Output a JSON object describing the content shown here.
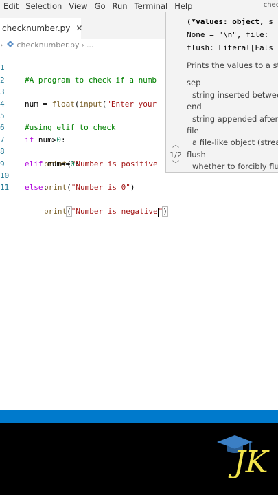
{
  "menu": {
    "items": [
      "Edit",
      "Selection",
      "View",
      "Go",
      "Run",
      "Terminal",
      "Help"
    ],
    "window_title_fragment": "check"
  },
  "tab": {
    "filename": "checknumber.py",
    "close_glyph": "✕"
  },
  "breadcrumb": {
    "chevron_left": "›",
    "filename": "checknumber.py",
    "chevron_right": "›",
    "ellipsis": "..."
  },
  "editor": {
    "line_numbers": [
      "1",
      "2",
      "3",
      "4",
      "5",
      "6",
      "7",
      "8",
      "9",
      "10",
      "11"
    ],
    "line1_comment": "#A program to check if a numb",
    "line3": {
      "var": "num",
      "eq": " = ",
      "f1": "float",
      "p1": "(",
      "f2": "input",
      "p2": "(",
      "str": "\"Enter your"
    },
    "line5_comment": "#using elif to check",
    "line6": {
      "kw": "if",
      "rest": " num>",
      "num": "0",
      "colon": ":"
    },
    "line7": {
      "fn": "print",
      "open": "(",
      "str": "\"Number is positive"
    },
    "line8": {
      "kw": "elif",
      "rest": " num==",
      "num": "0",
      "colon": ":"
    },
    "line9": {
      "fn": "print",
      "open": "(",
      "str": "\"Number is 0\"",
      "close": ")"
    },
    "line10": {
      "kw": "else",
      "colon": ":"
    },
    "line11": {
      "fn": "print",
      "open": "(",
      "str1": "\"Number is negative",
      "str2": "\"",
      "close": ")"
    }
  },
  "parameter_hint": {
    "sig_line1_bold": "(*values: object,",
    "sig_line1_rest": " s",
    "sig_line2": "None = \"\\n\", file:",
    "sig_line3": "flush: Literal[Fals",
    "doc_summary": "Prints the values to a st",
    "params": [
      {
        "name": "sep",
        "desc": "string inserted betwee"
      },
      {
        "name": "end",
        "desc": "string appended after"
      },
      {
        "name": "file",
        "desc": "a file-like object (strea"
      },
      {
        "name": "flush",
        "desc": "whether to forcibly flu"
      }
    ],
    "pager_up": "︿",
    "pager_count": "1/2",
    "pager_down": "﹀"
  },
  "logo": {
    "text": "JK",
    "icon": "graduation-cap-icon"
  },
  "colors": {
    "status_bar": "#007acc",
    "comment": "#008000",
    "keyword": "#af00db",
    "function": "#795e26",
    "string": "#a31515",
    "number": "#098658",
    "line_number": "#237893"
  }
}
